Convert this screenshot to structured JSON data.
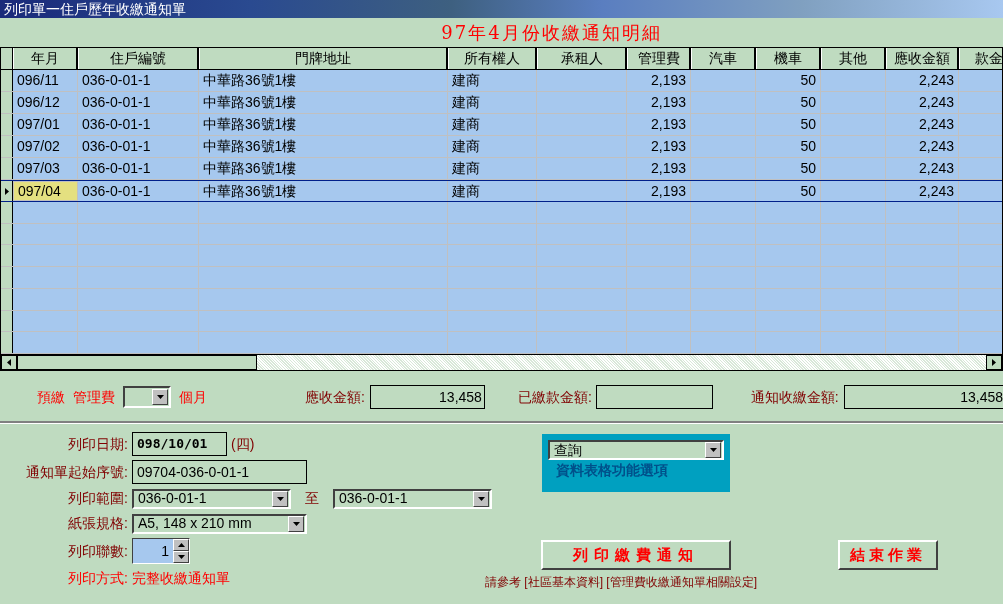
{
  "window": {
    "title": "列印單一住戶歷年收繳通知單"
  },
  "heading": "97年4月份收繳通知明細",
  "table": {
    "columns": [
      "年月",
      "住戶編號",
      "門牌地址",
      "所有權人",
      "承租人",
      "管理費",
      "汽車",
      "機車",
      "其他",
      "應收金額",
      "款金"
    ],
    "rows": [
      {
        "current": false,
        "cells": [
          "096/11",
          "036-0-01-1",
          "中華路36號1樓",
          "建商",
          "",
          "2,193",
          "",
          "50",
          "",
          "2,243",
          ""
        ]
      },
      {
        "current": false,
        "cells": [
          "096/12",
          "036-0-01-1",
          "中華路36號1樓",
          "建商",
          "",
          "2,193",
          "",
          "50",
          "",
          "2,243",
          ""
        ]
      },
      {
        "current": false,
        "cells": [
          "097/01",
          "036-0-01-1",
          "中華路36號1樓",
          "建商",
          "",
          "2,193",
          "",
          "50",
          "",
          "2,243",
          ""
        ]
      },
      {
        "current": false,
        "cells": [
          "097/02",
          "036-0-01-1",
          "中華路36號1樓",
          "建商",
          "",
          "2,193",
          "",
          "50",
          "",
          "2,243",
          ""
        ]
      },
      {
        "current": false,
        "cells": [
          "097/03",
          "036-0-01-1",
          "中華路36號1樓",
          "建商",
          "",
          "2,193",
          "",
          "50",
          "",
          "2,243",
          ""
        ]
      },
      {
        "current": true,
        "cells": [
          "097/04",
          "036-0-01-1",
          "中華路36號1樓",
          "建商",
          "",
          "2,193",
          "",
          "50",
          "",
          "2,243",
          ""
        ]
      }
    ]
  },
  "summary": {
    "prepay_label": "預繳",
    "prepay_item": "管理費",
    "months_label": "個月",
    "receivable_label": "應收金額:",
    "receivable": "13,458",
    "paid_label": "已繳款金額:",
    "notice_label": "通知收繳金額:",
    "notice_amount": "13,458"
  },
  "form": {
    "date_label": "列印日期:",
    "date": "098/10/01",
    "weekday": "(四)",
    "serial_label": "通知單起始序號:",
    "serial": "09704-036-0-01-1",
    "range_label": "列印範圍:",
    "range_from": "036-0-01-1",
    "range_to_label": "至",
    "range_to": "036-0-01-1",
    "paper_label": "紙張規格:",
    "paper": "A5, 148 x 210 mm",
    "copies_label": "列印聯數:",
    "copies": "1",
    "method_label": "列印方式:",
    "method": "完整收繳通知單"
  },
  "options_panel": {
    "value": "查詢",
    "caption": "資料表格功能選項"
  },
  "buttons": {
    "print": "列印繳費通知",
    "end": "結束作業"
  },
  "note": "請參考 [社區基本資料] [管理費收繳通知單相關設定]"
}
